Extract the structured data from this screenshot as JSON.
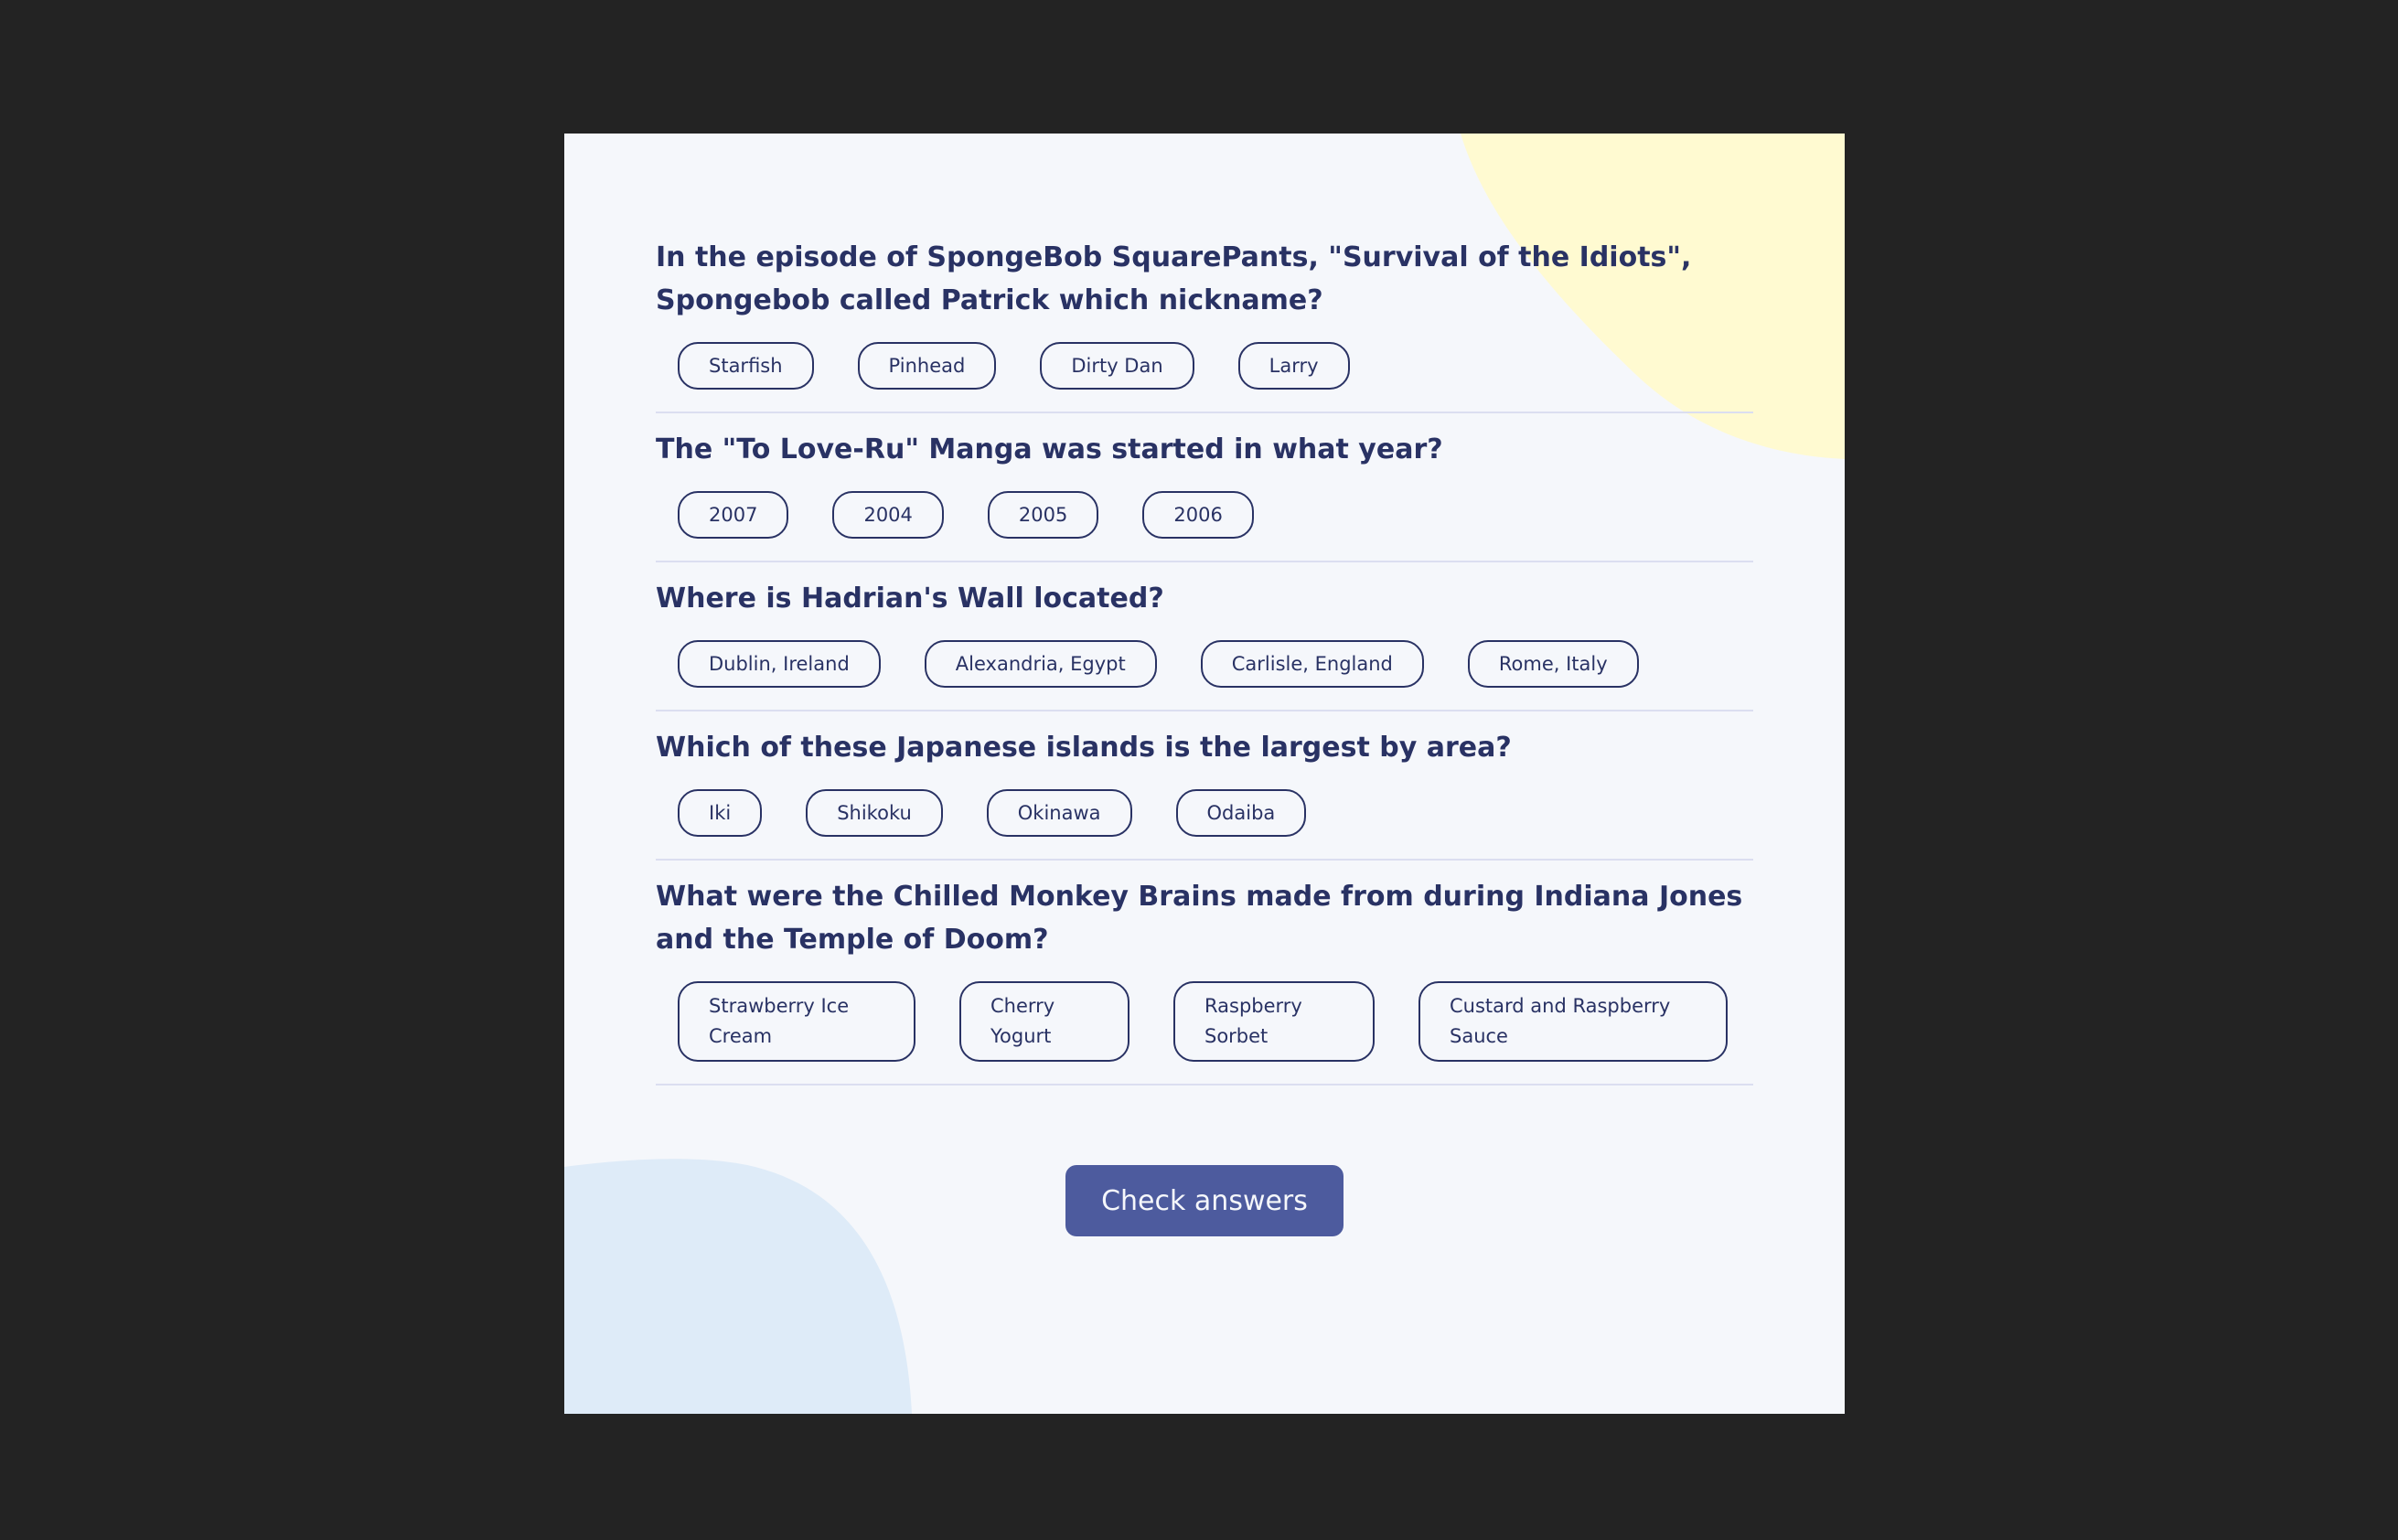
{
  "colors": {
    "background": "#232323",
    "card": "#F5F7FB",
    "text": "#293264",
    "divider": "#DBDEF0",
    "button": "#4D5B9E",
    "blob_yellow": "#FFFAD1",
    "blob_blue": "#DEEBF8"
  },
  "questions": [
    {
      "text": "In the episode of SpongeBob SquarePants, \"Survival of the Idiots\", Spongebob called Patrick which nickname?",
      "answers": [
        "Starfish",
        "Pinhead",
        "Dirty Dan",
        "Larry"
      ]
    },
    {
      "text": "The \"To Love-Ru\" Manga was started in what year?",
      "answers": [
        "2007",
        "2004",
        "2005",
        "2006"
      ]
    },
    {
      "text": "Where is Hadrian's Wall located?",
      "answers": [
        "Dublin, Ireland",
        "Alexandria, Egypt",
        "Carlisle, England",
        "Rome, Italy"
      ]
    },
    {
      "text": "Which of these Japanese islands is the largest by area?",
      "answers": [
        "Iki",
        "Shikoku",
        "Okinawa",
        "Odaiba"
      ]
    },
    {
      "text": "What were the Chilled Monkey Brains made from during Indiana Jones and the Temple of Doom?",
      "answers": [
        "Strawberry Ice Cream",
        "Cherry Yogurt",
        "Raspberry Sorbet",
        "Custard and Raspberry Sauce"
      ]
    }
  ],
  "check_button": {
    "label": "Check answers"
  }
}
